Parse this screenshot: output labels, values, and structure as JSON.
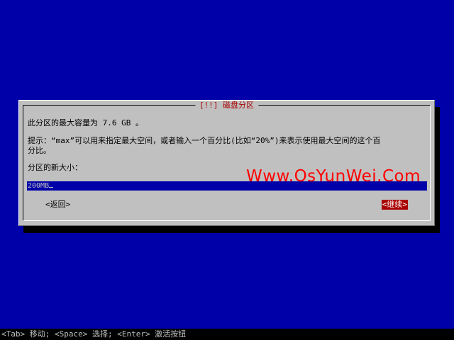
{
  "dialog": {
    "title": "[!!] 磁盘分区",
    "max_size_line": "此分区的最大容量为 7.6 GB 。",
    "hint_line1": "提示：“max”可以用来指定最大空间，或者输入一个百分比(比如“20%”)来表示使用最大空间的这个百",
    "hint_line2": "分比。",
    "prompt": "分区的新大小：",
    "input_value": "200MB",
    "back_button": "<返回>",
    "continue_button": "<继续>"
  },
  "watermark": "Www.OsYunWei.Com",
  "statusbar": "<Tab> 移动; <Space> 选择; <Enter> 激活按钮",
  "colors": {
    "background": "#0000a8",
    "dialog": "#c0c0c0",
    "title": "#a80000",
    "selected_button": "#a80000",
    "watermark": "#ff0000"
  }
}
